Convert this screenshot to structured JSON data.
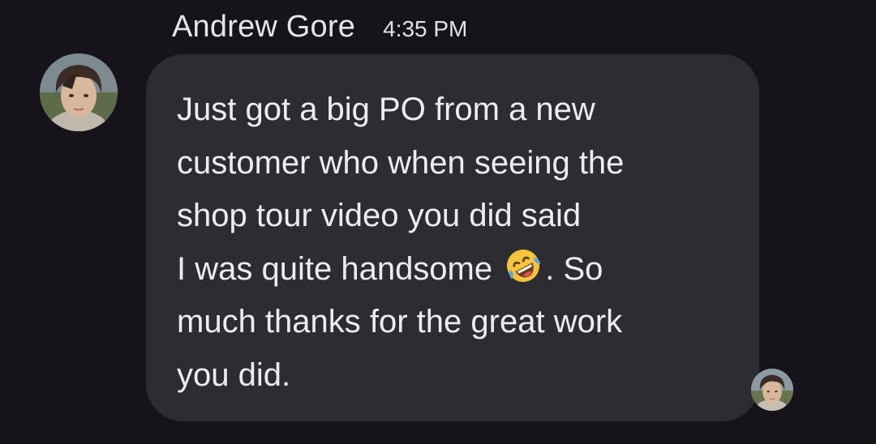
{
  "header": {
    "sender_name": "Andrew Gore",
    "timestamp": "4:35 PM"
  },
  "message": {
    "text_before_emoji": "Just got a big PO from a new\ncustomer who when seeing the\nshop tour video you did said\nI was quite handsome ",
    "emoji": "rolling-on-the-floor-laughing-emoji",
    "text_after_emoji": ". So\nmuch thanks for the great work\nyou did."
  },
  "avatars": {
    "sender": "profile-photo",
    "read_receipt": "profile-photo"
  },
  "colors": {
    "background": "#16141a",
    "bubble": "#2d2c31",
    "text": "#eeecf0"
  }
}
